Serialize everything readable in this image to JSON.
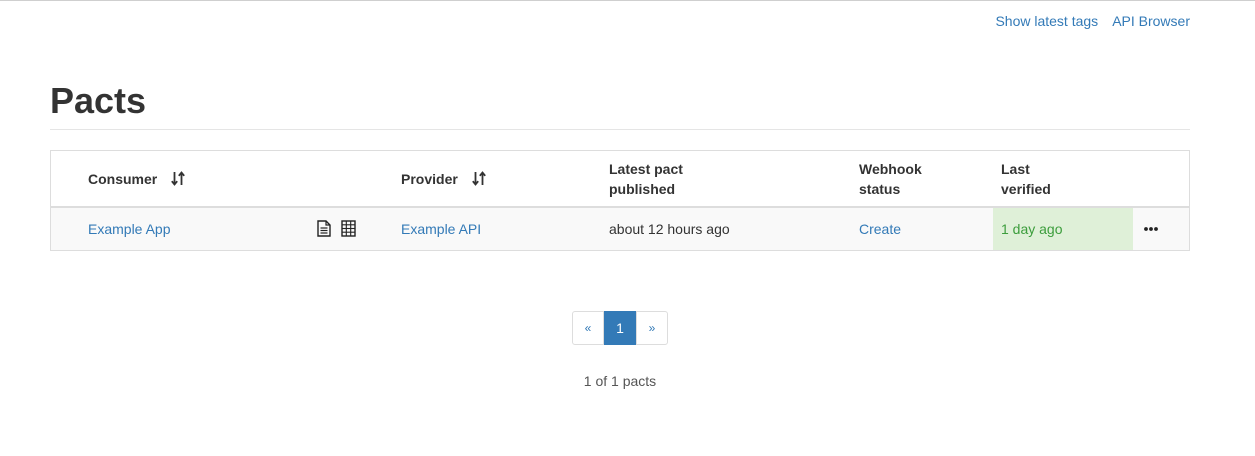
{
  "header": {
    "links": [
      "Show latest tags",
      "API Browser"
    ]
  },
  "page": {
    "title": "Pacts"
  },
  "table": {
    "columns": {
      "consumer": "Consumer",
      "provider": "Provider",
      "latest_pact_line1": "Latest pact",
      "latest_pact_line2": "published",
      "webhook_line1": "Webhook",
      "webhook_line2": "status",
      "verified_line1": "Last",
      "verified_line2": "verified"
    },
    "rows": [
      {
        "consumer": "Example App",
        "provider": "Example API",
        "latest_pact_published": "about 12 hours ago",
        "webhook_status": "Create",
        "last_verified": "1 day ago"
      }
    ],
    "icons": [
      "document-icon",
      "matrix-icon",
      "sort-icon",
      "more-options-icon"
    ]
  },
  "pagination": {
    "prev": "«",
    "current": "1",
    "next": "»",
    "summary": "1 of 1 pacts"
  },
  "colors": {
    "link": "#337ab7",
    "verified_bg": "#dff0d8",
    "verified_text": "#3c9d3c"
  }
}
